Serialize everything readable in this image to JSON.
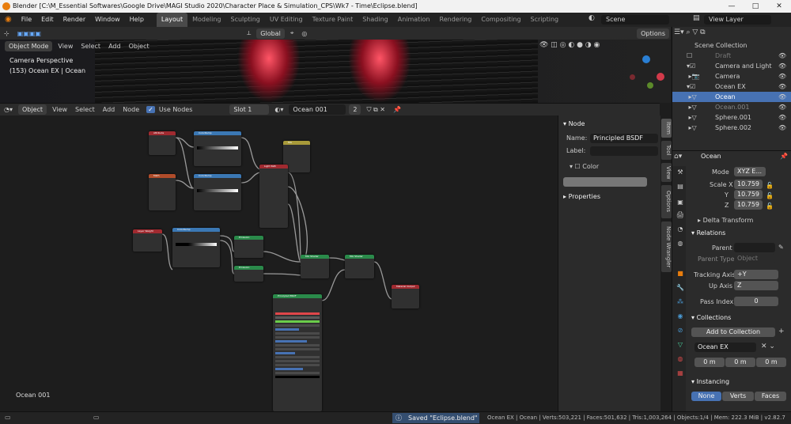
{
  "window": {
    "title": "Blender [C:\\M_Essential Softwares\\Google Drive\\MAGI Studio 2020\\Character Place & Simulation_CPS\\Wk7 - Time\\Eclipse.blend]",
    "min": "—",
    "max": "□",
    "close": "✕"
  },
  "menu": [
    "File",
    "Edit",
    "Render",
    "Window",
    "Help"
  ],
  "workspaces": [
    "Layout",
    "Modeling",
    "Sculpting",
    "UV Editing",
    "Texture Paint",
    "Shading",
    "Animation",
    "Rendering",
    "Compositing",
    "Scripting"
  ],
  "scene": "Scene",
  "view_layer": "View Layer",
  "viewport": {
    "mode": "Object Mode",
    "menus": [
      "View",
      "Select",
      "Add",
      "Object"
    ],
    "transform": "Global",
    "options": "Options",
    "overlay1": "Camera Perspective",
    "overlay2": "(153) Ocean EX | Ocean"
  },
  "node_header": {
    "type": "Object",
    "menus": [
      "View",
      "Select",
      "Add",
      "Node"
    ],
    "use_nodes": "Use Nodes",
    "slot": "Slot 1",
    "material": "Ocean 001",
    "users": "2"
  },
  "node_editor": {
    "label": "Ocean 001"
  },
  "nodes": {
    "n1": "Attribute",
    "n2": "ColorRamp",
    "n3": "Mix",
    "n4": "Math",
    "n5": "ColorRamp",
    "n6": "Light Path",
    "n7": "Layer Weight",
    "n8": "ColorRamp",
    "n9": "Emission",
    "n10": "Emission",
    "n11": "Mix Shader",
    "n12": "Mix Shader",
    "n13": "Material Output",
    "n14": "Principled BSDF"
  },
  "npanel": {
    "section": "Node",
    "name_label": "Name:",
    "name": "Principled BSDF",
    "label_label": "Label:",
    "color": "Color",
    "properties": "Properties"
  },
  "vtabs": [
    "Item",
    "Tool",
    "View",
    "Options",
    "Node Wrangler"
  ],
  "outliner": {
    "root": "Scene Collection",
    "items": [
      {
        "name": "Draft"
      },
      {
        "name": "Camera and Light"
      },
      {
        "name": "Camera"
      },
      {
        "name": "Ocean EX"
      },
      {
        "name": "Ocean"
      },
      {
        "name": "Ocean.001"
      },
      {
        "name": "Sphere.001"
      },
      {
        "name": "Sphere.002"
      }
    ]
  },
  "props": {
    "object": "Ocean",
    "mode_label": "Mode",
    "mode": "XYZ E...",
    "scale_x_label": "Scale X",
    "scale_x": "10.759",
    "y_label": "Y",
    "scale_y": "10.759",
    "z_label": "Z",
    "scale_z": "10.759",
    "delta": "Delta Transform",
    "relations": "Relations",
    "parent": "Parent",
    "parent_type": "Parent Type",
    "parent_type_val": "Object",
    "tracking": "Tracking Axis",
    "tracking_val": "+Y",
    "up": "Up Axis",
    "up_val": "Z",
    "pass": "Pass Index",
    "pass_val": "0",
    "collections": "Collections",
    "add_coll": "Add to Collection",
    "coll_name": "Ocean EX",
    "m1": "0 m",
    "m2": "0 m",
    "m3": "0 m",
    "instancing": "Instancing",
    "inst": [
      "None",
      "Verts",
      "Faces"
    ]
  },
  "status": {
    "msg": "Saved \"Eclipse.blend\"",
    "stats": "Ocean EX | Ocean | Verts:503,221 | Faces:501,632 | Tris:1,003,264 | Objects:1/4 | Mem: 222.3 MiB | v2.82.7"
  }
}
